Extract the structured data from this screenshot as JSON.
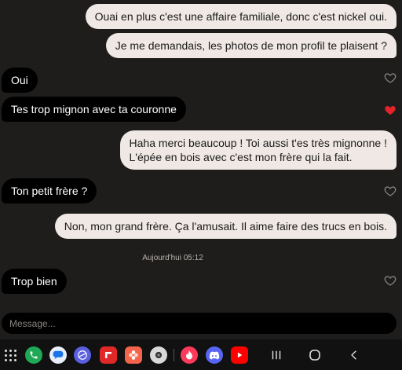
{
  "messages": [
    {
      "text": "Ouai en plus c'est une affaire familiale, donc c'est nickel oui."
    },
    {
      "text": "Je me demandais, les photos de mon profil te plaisent ?"
    },
    {
      "text": "Oui",
      "liked": false
    },
    {
      "text": "Tes trop mignon avec ta couronne",
      "liked": true
    },
    {
      "line1": "Haha merci beaucoup ! Toi aussi t'es très mignonne !",
      "line2": "L'épée en bois avec c'est mon frère qui la fait."
    },
    {
      "text": "Ton petit frère ?",
      "liked": false
    },
    {
      "text": "Non, mon grand frère. Ça l'amusait. Il aime faire des trucs en bois."
    },
    {
      "text": "Trop bien",
      "liked": false
    }
  ],
  "timestamp": "Aujourd'hui 05:12",
  "composer": {
    "placeholder": "Message..."
  },
  "colors": {
    "background": "#1e1d1c",
    "outgoing_bubble": "#efe8e4",
    "incoming_bubble": "#000000",
    "heart_liked": "#e0242a",
    "heart_outline": "#8c8784"
  },
  "navbar": {
    "apps": [
      "phone-icon",
      "messages-icon",
      "browser-icon",
      "flipboard-icon",
      "photos-icon",
      "camera-icon",
      "tinder-icon",
      "discord-icon",
      "youtube-icon"
    ],
    "system": [
      "recent-apps-icon",
      "home-icon",
      "back-icon"
    ]
  }
}
